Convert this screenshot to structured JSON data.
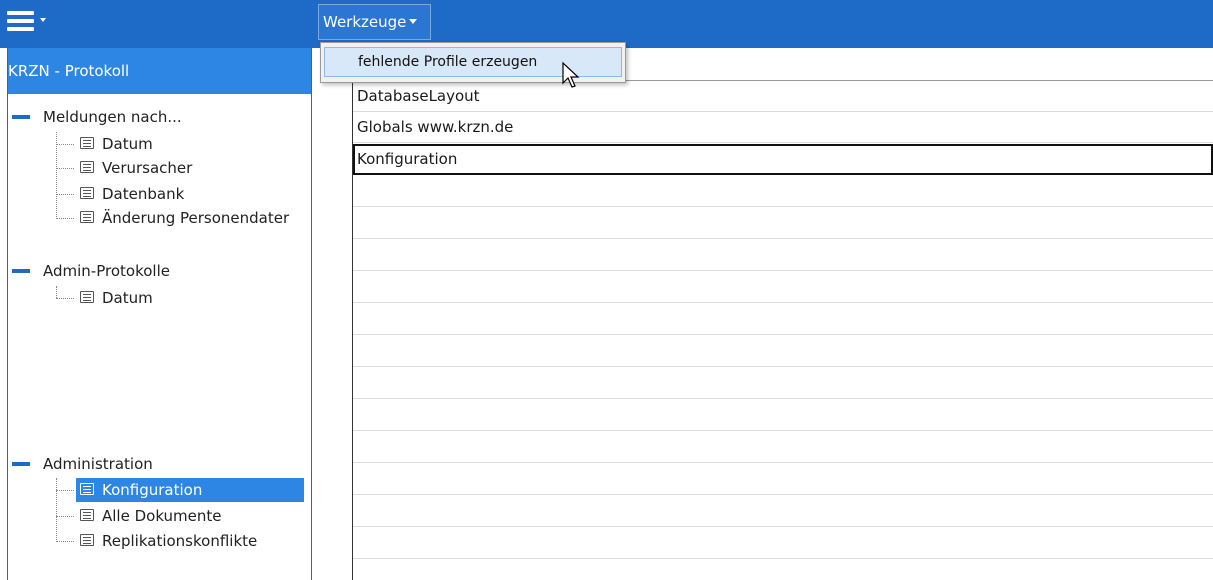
{
  "topbar": {
    "menu_icon": "hamburger-menu-icon",
    "tools_menu_label": "Werkzeuge"
  },
  "dropdown": {
    "items": [
      "fehlende Profile erzeugen"
    ]
  },
  "sidebar": {
    "title": "KRZN - Protokoll",
    "groups": [
      {
        "label": "Meldungen nach...",
        "items": [
          "Datum",
          "Verursacher",
          "Datenbank",
          "Änderung Personendater"
        ]
      },
      {
        "label": "Admin-Protokolle",
        "items": [
          "Datum"
        ]
      },
      {
        "label": "Administration",
        "items": [
          "Konfiguration",
          "Alle Dokumente",
          "Replikationskonflikte"
        ],
        "selected": "Konfiguration"
      }
    ]
  },
  "main": {
    "rows": [
      "DatabaseLayout",
      "Globals www.krzn.de",
      "Konfiguration"
    ],
    "focused_row": "Konfiguration"
  },
  "colors": {
    "topbar": "#1e6ac7",
    "sidebar_title": "#2d86e3",
    "selection": "#2d86e3"
  }
}
